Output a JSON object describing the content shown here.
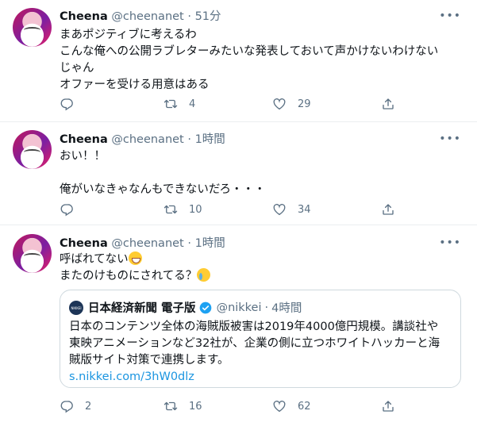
{
  "tweets": [
    {
      "name": "Cheena",
      "handle": "@cheenanet",
      "time": "51分",
      "lines": [
        "まあポジティブに考えるわ",
        "こんな俺への公開ラブレターみたいな発表しておいて声かけないわけない",
        "じゃん",
        "オファーを受ける用意はある"
      ],
      "replies": "",
      "retweets": "4",
      "likes": "29"
    },
    {
      "name": "Cheena",
      "handle": "@cheenanet",
      "time": "1時間",
      "lines": [
        "おい！！",
        "",
        "俺がいなきゃなんもできないだろ・・・"
      ],
      "replies": "",
      "retweets": "10",
      "likes": "34"
    },
    {
      "name": "Cheena",
      "handle": "@cheenanet",
      "time": "1時間",
      "lines": [
        "呼ばれてない",
        "またのけものにされてる？"
      ],
      "emoji": [
        "grinning-squinting-face",
        "crying-face"
      ],
      "replies": "2",
      "retweets": "16",
      "likes": "62",
      "quote": {
        "logo_text": "NIKKEI",
        "name": "日本経済新聞 電子版",
        "handle": "@nikkei",
        "time": "4時間",
        "lines": [
          "日本のコンテンツ全体の海賊版被害は2019年4000億円規模。講談社や",
          "東映アニメーションなど32社が、企業の側に立つホワイトハッカーと海",
          "賊版サイト対策で連携します。"
        ],
        "link": "s.nikkei.com/3hW0dlz"
      }
    }
  ],
  "separator": "·",
  "more_glyph": "•••",
  "colors": {
    "text": "#0f1419",
    "secondary": "#5b7083",
    "link": "#1b95e0",
    "verified": "#1da1f2",
    "border": "#ebeef0"
  }
}
